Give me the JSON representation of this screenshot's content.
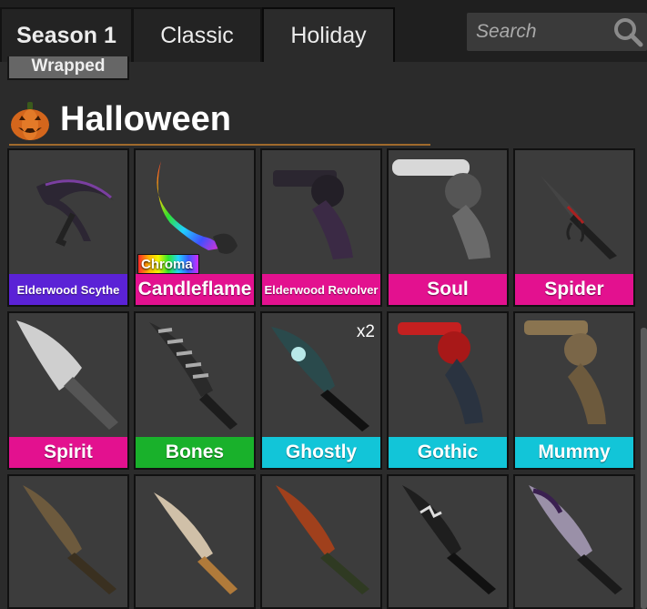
{
  "tabs": [
    {
      "label": "Season 1",
      "active": false
    },
    {
      "label": "Classic",
      "active": false
    },
    {
      "label": "Holiday",
      "active": true
    }
  ],
  "search": {
    "placeholder": "Search",
    "icon": "search-icon"
  },
  "wrapped_label": "Wrapped",
  "section": {
    "title": "Halloween",
    "icon": "pumpkin-icon"
  },
  "items": [
    {
      "name": "Elderwood Scythe",
      "color": "#5b22d6",
      "badge": ""
    },
    {
      "name": "Candleflame",
      "color": "#e3118f",
      "badge": "Chroma"
    },
    {
      "name": "Elderwood Revolver",
      "color": "#e3118f",
      "badge": ""
    },
    {
      "name": "Soul",
      "color": "#e3118f",
      "badge": ""
    },
    {
      "name": "Spider",
      "color": "#e3118f",
      "badge": ""
    },
    {
      "name": "Spirit",
      "color": "#e3118f",
      "badge": ""
    },
    {
      "name": "Bones",
      "color": "#19b12b",
      "badge": ""
    },
    {
      "name": "Ghostly",
      "color": "#12c5d8",
      "badge": "",
      "count": "x2"
    },
    {
      "name": "Gothic",
      "color": "#12c5d8",
      "badge": ""
    },
    {
      "name": "Mummy",
      "color": "#12c5d8",
      "badge": ""
    },
    {
      "name": "",
      "color": "#12c5d8",
      "badge": ""
    },
    {
      "name": "",
      "color": "#12c5d8",
      "badge": ""
    },
    {
      "name": "",
      "color": "#12c5d8",
      "badge": ""
    },
    {
      "name": "",
      "color": "#8a8a8a",
      "badge": ""
    },
    {
      "name": "",
      "color": "#8a8a8a",
      "badge": ""
    }
  ]
}
